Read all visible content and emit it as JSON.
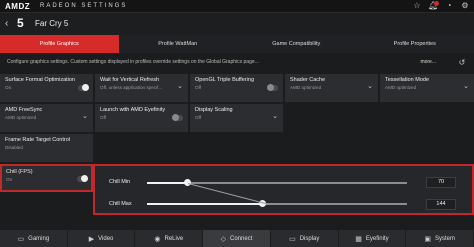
{
  "titlebar": {
    "logo": "AMDZ",
    "title": "RADEON SETTINGS",
    "icons": [
      "star-icon",
      "bell-icon",
      "user-icon",
      "gear-icon"
    ]
  },
  "game": {
    "name": "Far Cry 5",
    "icon_text": "5"
  },
  "tabs": [
    "Profile Graphics",
    "Profile WattMan",
    "Game Compatibility",
    "Profile Properties"
  ],
  "description": "Configure graphics settings. Custom settings displayed in profiles override settings on the Global Graphics page...",
  "more_label": "more...",
  "settings": [
    {
      "title": "Surface Format Optimization",
      "sub": "On",
      "control": "toggle",
      "state": "on"
    },
    {
      "title": "Wait for Vertical Refresh",
      "sub": "Off, unless application specif...",
      "control": "dropdown"
    },
    {
      "title": "OpenGL Triple Buffering",
      "sub": "Off",
      "control": "toggle",
      "state": "off"
    },
    {
      "title": "Shader Cache",
      "sub": "AMD optimized",
      "control": "dropdown"
    },
    {
      "title": "Tessellation Mode",
      "sub": "AMD optimized",
      "control": "dropdown"
    },
    {
      "title": "AMD FreeSync",
      "sub": "AMD optimized",
      "control": "dropdown"
    },
    {
      "title": "Launch with AMD Eyefinity",
      "sub": "Off",
      "control": "toggle",
      "state": "off"
    },
    {
      "title": "Display Scaling",
      "sub": "Off",
      "control": "dropdown"
    },
    {
      "title": "Frame Rate Target Control",
      "sub": "Disabled",
      "control": "none"
    }
  ],
  "chill": {
    "title": "Chill (FPS)",
    "sub": "On",
    "min_label": "Chill Min",
    "max_label": "Chill Max",
    "min_value": "70",
    "max_value": "144",
    "accent": "#c0282a"
  },
  "nav": [
    {
      "label": "Gaming",
      "icon": "gamepad-icon"
    },
    {
      "label": "Video",
      "icon": "play-icon"
    },
    {
      "label": "ReLive",
      "icon": "record-icon"
    },
    {
      "label": "Connect",
      "icon": "connect-icon",
      "active": true
    },
    {
      "label": "Display",
      "icon": "monitor-icon"
    },
    {
      "label": "Eyefinity",
      "icon": "eyefinity-icon"
    },
    {
      "label": "System",
      "icon": "system-icon"
    }
  ],
  "colors": {
    "accent": "#d72a2a",
    "panel": "#2c2d30",
    "background": "#1b1c1e"
  }
}
